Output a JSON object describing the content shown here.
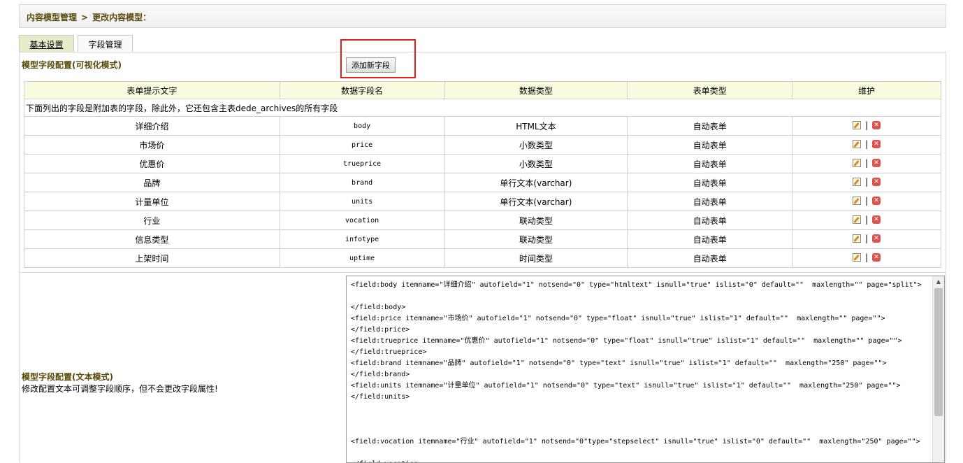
{
  "breadcrumb": {
    "root": "内容模型管理",
    "sep": ">",
    "current": "更改内容模型："
  },
  "tabs": [
    {
      "label": "基本设置"
    },
    {
      "label": "字段管理"
    }
  ],
  "visual_section": {
    "title": "模型字段配置(可视化模式)",
    "add_button": "添加新字段"
  },
  "table": {
    "headers": [
      "表单提示文字",
      "数据字段名",
      "数据类型",
      "表单类型",
      "维护"
    ],
    "note": "下面列出的字段是附加表的字段，除此外，它还包含主表dede_archives的所有字段",
    "sep": "|",
    "rows": [
      {
        "label": "详细介绍",
        "field": "body",
        "dtype": "HTML文本",
        "ftype": "自动表单"
      },
      {
        "label": "市场价",
        "field": "price",
        "dtype": "小数类型",
        "ftype": "自动表单"
      },
      {
        "label": "优惠价",
        "field": "trueprice",
        "dtype": "小数类型",
        "ftype": "自动表单"
      },
      {
        "label": "品牌",
        "field": "brand",
        "dtype": "单行文本(varchar)",
        "ftype": "自动表单"
      },
      {
        "label": "计量单位",
        "field": "units",
        "dtype": "单行文本(varchar)",
        "ftype": "自动表单"
      },
      {
        "label": "行业",
        "field": "vocation",
        "dtype": "联动类型",
        "ftype": "自动表单"
      },
      {
        "label": "信息类型",
        "field": "infotype",
        "dtype": "联动类型",
        "ftype": "自动表单"
      },
      {
        "label": "上架时间",
        "field": "uptime",
        "dtype": "时间类型",
        "ftype": "自动表单"
      }
    ]
  },
  "text_section": {
    "title": "模型字段配置(文本模式)",
    "desc": "修改配置文本可调整字段顺序，但不会更改字段属性!",
    "code": "<field:body itemname=\"详细介绍\" autofield=\"1\" notsend=\"0\" type=\"htmltext\" isnull=\"true\" islist=\"0\" default=\"\"  maxlength=\"\" page=\"split\">\n\n</field:body>\n<field:price itemname=\"市场价\" autofield=\"1\" notsend=\"0\" type=\"float\" isnull=\"true\" islist=\"1\" default=\"\"  maxlength=\"\" page=\"\">\n</field:price>\n<field:trueprice itemname=\"优惠价\" autofield=\"1\" notsend=\"0\" type=\"float\" isnull=\"true\" islist=\"1\" default=\"\"  maxlength=\"\" page=\"\">\n</field:trueprice>\n<field:brand itemname=\"品牌\" autofield=\"1\" notsend=\"0\" type=\"text\" isnull=\"true\" islist=\"1\" default=\"\"  maxlength=\"250\" page=\"\">\n</field:brand>\n<field:units itemname=\"计量单位\" autofield=\"1\" notsend=\"0\" type=\"text\" isnull=\"true\" islist=\"1\" default=\"\"  maxlength=\"250\" page=\"\">\n</field:units>\n\n\n\n<field:vocation itemname=\"行业\" autofield=\"1\" notsend=\"0\"type=\"stepselect\" isnull=\"true\" islist=\"0\" default=\"\"  maxlength=\"250\" page=\"\">\n\n</field:vocation>"
  }
}
